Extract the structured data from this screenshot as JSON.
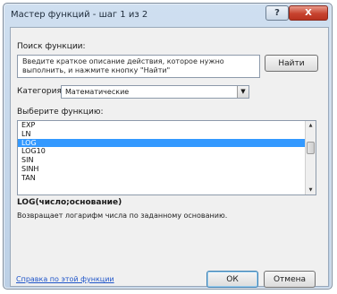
{
  "window": {
    "title": "Мастер функций - шаг 1 из 2",
    "help_glyph": "?",
    "close_glyph": "X"
  },
  "search": {
    "label": "Поиск функции:",
    "value": "Введите краткое описание действия, которое нужно выполнить, и нажмите кнопку \"Найти\"",
    "find_button": "Найти"
  },
  "category": {
    "label": "Категория:",
    "value": "Математические"
  },
  "functions": {
    "label": "Выберите функцию:",
    "items": [
      "EXP",
      "LN",
      "LOG",
      "LOG10",
      "SIN",
      "SINH",
      "TAN"
    ],
    "selected": "LOG"
  },
  "details": {
    "signature": "LOG(число;основание)",
    "description": "Возвращает логарифм числа по заданному основанию."
  },
  "footer": {
    "help_link": "Справка по этой функции",
    "ok": "ОК",
    "cancel": "Отмена"
  }
}
